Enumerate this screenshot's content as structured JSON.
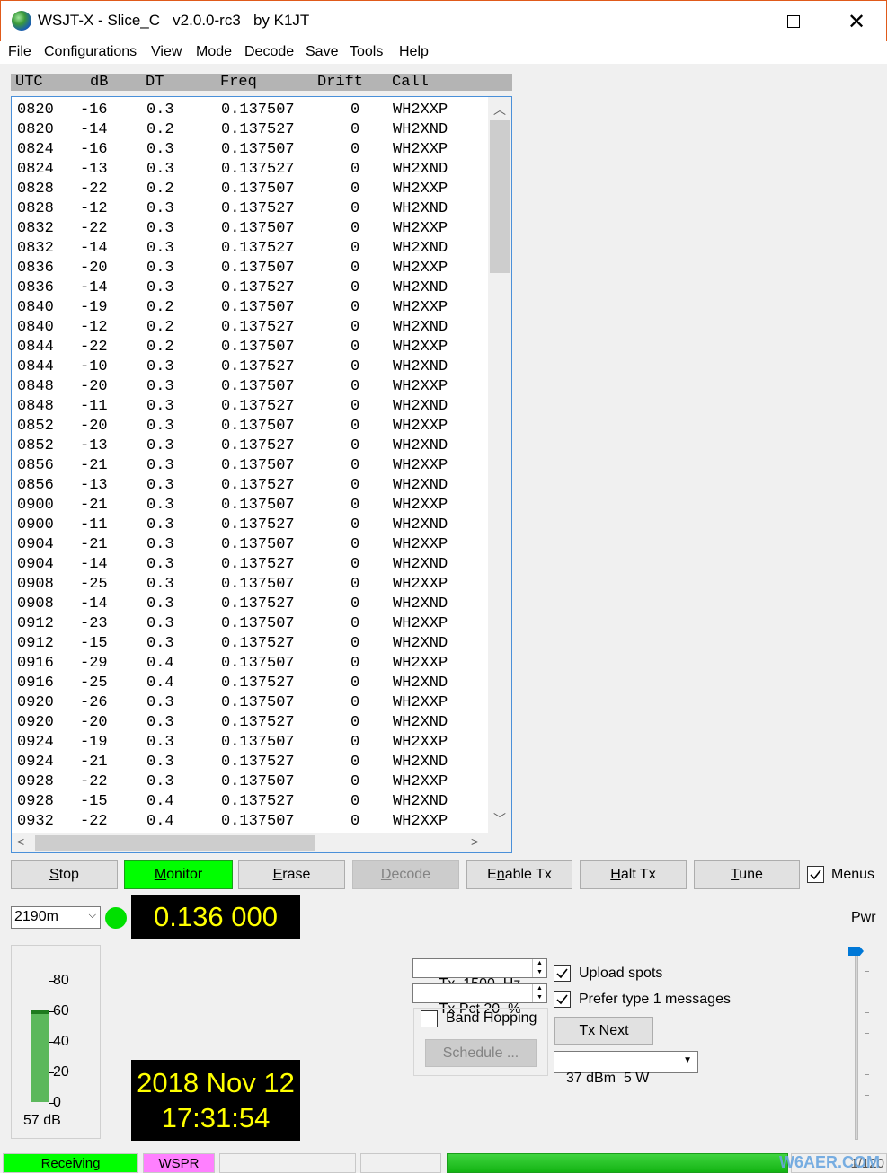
{
  "window": {
    "title": "WSJT-X - Slice_C   v2.0.0-rc3   by K1JT",
    "app_icon": "globe-icon"
  },
  "menu": [
    "File",
    "Configurations",
    "View",
    "Mode",
    "Decode",
    "Save",
    "Tools",
    "Help"
  ],
  "decode_table": {
    "headers": [
      "UTC",
      "dB",
      "DT",
      "Freq",
      "Drift",
      "Call"
    ],
    "rows": [
      [
        "0820",
        "-16",
        "0.3",
        "0.137507",
        "0",
        "WH2XXP"
      ],
      [
        "0820",
        "-14",
        "0.2",
        "0.137527",
        "0",
        "WH2XND"
      ],
      [
        "0824",
        "-16",
        "0.3",
        "0.137507",
        "0",
        "WH2XXP"
      ],
      [
        "0824",
        "-13",
        "0.3",
        "0.137527",
        "0",
        "WH2XND"
      ],
      [
        "0828",
        "-22",
        "0.2",
        "0.137507",
        "0",
        "WH2XXP"
      ],
      [
        "0828",
        "-12",
        "0.3",
        "0.137527",
        "0",
        "WH2XND"
      ],
      [
        "0832",
        "-22",
        "0.3",
        "0.137507",
        "0",
        "WH2XXP"
      ],
      [
        "0832",
        "-14",
        "0.3",
        "0.137527",
        "0",
        "WH2XND"
      ],
      [
        "0836",
        "-20",
        "0.3",
        "0.137507",
        "0",
        "WH2XXP"
      ],
      [
        "0836",
        "-14",
        "0.3",
        "0.137527",
        "0",
        "WH2XND"
      ],
      [
        "0840",
        "-19",
        "0.2",
        "0.137507",
        "0",
        "WH2XXP"
      ],
      [
        "0840",
        "-12",
        "0.2",
        "0.137527",
        "0",
        "WH2XND"
      ],
      [
        "0844",
        "-22",
        "0.2",
        "0.137507",
        "0",
        "WH2XXP"
      ],
      [
        "0844",
        "-10",
        "0.3",
        "0.137527",
        "0",
        "WH2XND"
      ],
      [
        "0848",
        "-20",
        "0.3",
        "0.137507",
        "0",
        "WH2XXP"
      ],
      [
        "0848",
        "-11",
        "0.3",
        "0.137527",
        "0",
        "WH2XND"
      ],
      [
        "0852",
        "-20",
        "0.3",
        "0.137507",
        "0",
        "WH2XXP"
      ],
      [
        "0852",
        "-13",
        "0.3",
        "0.137527",
        "0",
        "WH2XND"
      ],
      [
        "0856",
        "-21",
        "0.3",
        "0.137507",
        "0",
        "WH2XXP"
      ],
      [
        "0856",
        "-13",
        "0.3",
        "0.137527",
        "0",
        "WH2XND"
      ],
      [
        "0900",
        "-21",
        "0.3",
        "0.137507",
        "0",
        "WH2XXP"
      ],
      [
        "0900",
        "-11",
        "0.3",
        "0.137527",
        "0",
        "WH2XND"
      ],
      [
        "0904",
        "-21",
        "0.3",
        "0.137507",
        "0",
        "WH2XXP"
      ],
      [
        "0904",
        "-14",
        "0.3",
        "0.137527",
        "0",
        "WH2XND"
      ],
      [
        "0908",
        "-25",
        "0.3",
        "0.137507",
        "0",
        "WH2XXP"
      ],
      [
        "0908",
        "-14",
        "0.3",
        "0.137527",
        "0",
        "WH2XND"
      ],
      [
        "0912",
        "-23",
        "0.3",
        "0.137507",
        "0",
        "WH2XXP"
      ],
      [
        "0912",
        "-15",
        "0.3",
        "0.137527",
        "0",
        "WH2XND"
      ],
      [
        "0916",
        "-29",
        "0.4",
        "0.137507",
        "0",
        "WH2XXP"
      ],
      [
        "0916",
        "-25",
        "0.4",
        "0.137527",
        "0",
        "WH2XND"
      ],
      [
        "0920",
        "-26",
        "0.3",
        "0.137507",
        "0",
        "WH2XXP"
      ],
      [
        "0920",
        "-20",
        "0.3",
        "0.137527",
        "0",
        "WH2XND"
      ],
      [
        "0924",
        "-19",
        "0.3",
        "0.137507",
        "0",
        "WH2XXP"
      ],
      [
        "0924",
        "-21",
        "0.3",
        "0.137527",
        "0",
        "WH2XND"
      ],
      [
        "0928",
        "-22",
        "0.3",
        "0.137507",
        "0",
        "WH2XXP"
      ],
      [
        "0928",
        "-15",
        "0.4",
        "0.137527",
        "0",
        "WH2XND"
      ],
      [
        "0932",
        "-22",
        "0.4",
        "0.137507",
        "0",
        "WH2XXP"
      ]
    ]
  },
  "buttons": {
    "stop": "Stop",
    "monitor": "Monitor",
    "erase": "Erase",
    "decode": "Decode",
    "enable_tx": "Enable Tx",
    "halt_tx": "Halt Tx",
    "tune": "Tune",
    "menus_label": "Menus"
  },
  "band": {
    "selected": "2190m"
  },
  "dial_frequency": "0.136 000",
  "level_meter": {
    "ticks": [
      "80",
      "60",
      "40",
      "20",
      "0"
    ],
    "reading": "57 dB",
    "level_db": 57
  },
  "clock": {
    "date": "2018 Nov 12",
    "time": "17:31:54"
  },
  "tx_controls": {
    "tx_freq": "Tx  1500  Hz",
    "tx_pct": "Tx Pct 20  %",
    "band_hopping": "Band Hopping",
    "schedule": "Schedule ...",
    "upload_spots": "Upload spots",
    "prefer_type1": "Prefer type 1 messages",
    "tx_next": "Tx Next",
    "power": "37 dBm  5 W"
  },
  "power_slider": {
    "label": "Pwr",
    "level": 1.0
  },
  "status": {
    "receiving": "Receiving",
    "mode": "WSPR",
    "counter": "1/120"
  },
  "watermark": "W6AER.COM",
  "colors": {
    "led_green": "#00e000",
    "display_yellow": "#ffff00",
    "monitor_green": "#00ff00",
    "wspr_pink": "#ff80ff",
    "slider_blue": "#0078d7"
  }
}
